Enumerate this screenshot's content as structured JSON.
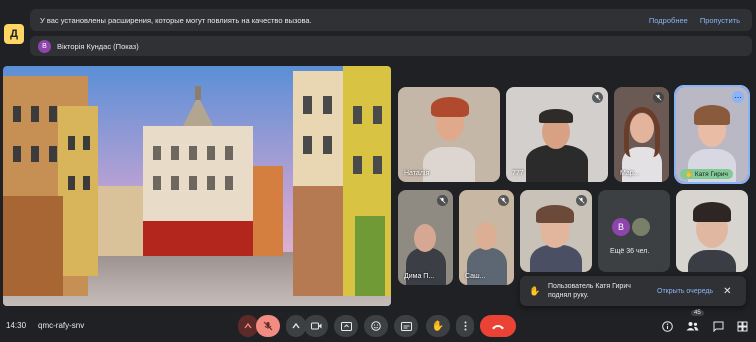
{
  "banner": {
    "message": "У вас установлены расширения, которые могут повлиять на качество вызова.",
    "more_label": "Подробнее",
    "skip_label": "Пропустить"
  },
  "presenting": {
    "avatar_letter": "В",
    "label": "Вікторія Кундас (Показ)"
  },
  "participants": [
    {
      "name": "Наталія"
    },
    {
      "name": "777"
    },
    {
      "name": "Мар..."
    },
    {
      "name": "Катя Гирич"
    },
    {
      "name": "Дима П..."
    },
    {
      "name": "Саш..."
    },
    {
      "name": ""
    },
    {
      "name": "Ещё 36 чел."
    },
    {
      "name": ""
    }
  ],
  "others_tile": {
    "avatar_letter": "В",
    "label": "Ещё 36 чел."
  },
  "toast": {
    "message": "Пользователь Катя Гирич поднял руку.",
    "action_label": "Открыть очередь"
  },
  "meeting": {
    "time": "14:30",
    "code": "qmc-rafy-snv",
    "participants_count": "45"
  },
  "colors": {
    "background": "#202124",
    "hangup": "#ea4335",
    "link": "#8ab4f8",
    "speaking": "#81c995"
  },
  "icons": {
    "warning": "warning-icon",
    "mic_off": "mic-off-icon",
    "camera": "camera-icon",
    "present": "present-icon",
    "emoji": "emoji-icon",
    "captions": "captions-icon",
    "hand": "raise-hand-icon",
    "more": "more-vert-icon",
    "hangup": "hangup-icon",
    "info": "info-icon",
    "people": "people-icon",
    "apps": "apps-icon"
  }
}
